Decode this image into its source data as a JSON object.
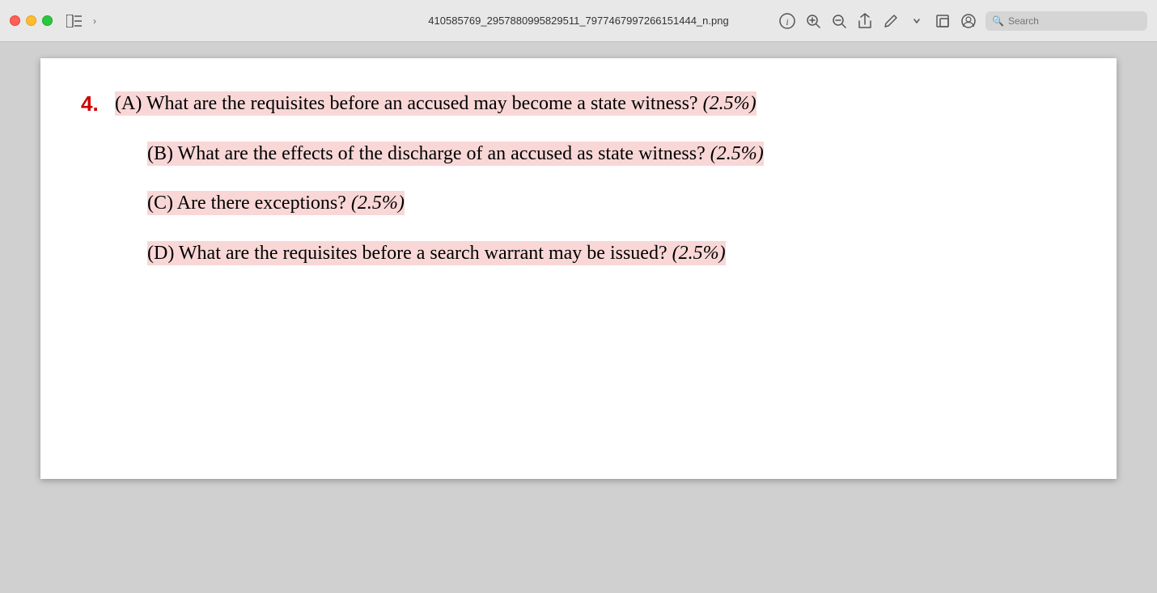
{
  "titlebar": {
    "filename": "410585769_2957880995829511_7977467997266151444_n.png",
    "traffic_lights": [
      "close",
      "minimize",
      "maximize"
    ],
    "search_placeholder": "Search"
  },
  "toolbar_icons": {
    "info": "ℹ",
    "zoom_in": "🔍",
    "zoom_out": "🔍",
    "share": "⬆",
    "pen": "✏",
    "expand": "⊞",
    "account": "⊙"
  },
  "document": {
    "question_number": "4.",
    "parts": [
      {
        "id": "A",
        "text": "(A) What are the requisites before an accused may become a state witness?",
        "points": "(2.5%)",
        "highlight": true
      },
      {
        "id": "B",
        "text": "(B) What are the effects of the discharge of an accused as state witness?",
        "points": "(2.5%)",
        "highlight": true
      },
      {
        "id": "C",
        "text": "(C) Are there exceptions?",
        "points": "(2.5%)",
        "highlight": true
      },
      {
        "id": "D",
        "text": "(D) What are the requisites before a search warrant may be issued?",
        "points": "(2.5%)",
        "highlight": true
      }
    ]
  }
}
